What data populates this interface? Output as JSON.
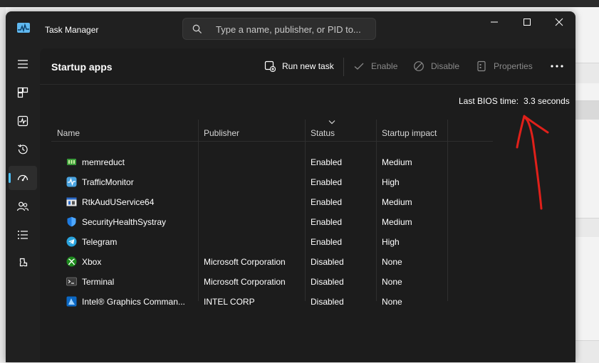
{
  "window": {
    "title": "Task Manager",
    "search_placeholder": "Type a name, publisher, or PID to..."
  },
  "sidebar": {
    "items": [
      {
        "name": "hamburger-menu-icon",
        "active": false
      },
      {
        "name": "processes-icon",
        "active": false
      },
      {
        "name": "performance-icon",
        "active": false
      },
      {
        "name": "app-history-icon",
        "active": false
      },
      {
        "name": "startup-apps-icon",
        "active": true
      },
      {
        "name": "users-icon",
        "active": false
      },
      {
        "name": "details-icon",
        "active": false
      },
      {
        "name": "services-icon",
        "active": false
      }
    ]
  },
  "toolbar": {
    "title": "Startup apps",
    "run_new_task": "Run new task",
    "enable": "Enable",
    "disable": "Disable",
    "properties": "Properties"
  },
  "bios": {
    "label": "Last BIOS time:",
    "value": "3.3 seconds"
  },
  "table": {
    "columns": [
      "Name",
      "Publisher",
      "Status",
      "Startup impact"
    ],
    "sorted_column": "Status",
    "rows": [
      {
        "icon": "memreduct-icon",
        "name": "memreduct",
        "publisher": "",
        "status": "Enabled",
        "impact": "Medium"
      },
      {
        "icon": "trafficmonitor-icon",
        "name": "TrafficMonitor",
        "publisher": "",
        "status": "Enabled",
        "impact": "High"
      },
      {
        "icon": "rtkaudio-icon",
        "name": "RtkAudUService64",
        "publisher": "",
        "status": "Enabled",
        "impact": "Medium"
      },
      {
        "icon": "security-shield-icon",
        "name": "SecurityHealthSystray",
        "publisher": "",
        "status": "Enabled",
        "impact": "Medium"
      },
      {
        "icon": "telegram-icon",
        "name": "Telegram",
        "publisher": "",
        "status": "Enabled",
        "impact": "High"
      },
      {
        "icon": "xbox-icon",
        "name": "Xbox",
        "publisher": "Microsoft Corporation",
        "status": "Disabled",
        "impact": "None"
      },
      {
        "icon": "terminal-icon",
        "name": "Terminal",
        "publisher": "Microsoft Corporation",
        "status": "Disabled",
        "impact": "None"
      },
      {
        "icon": "intel-graphics-icon",
        "name": "Intel® Graphics Comman...",
        "publisher": "INTEL CORP",
        "status": "Disabled",
        "impact": "None"
      }
    ]
  },
  "colors": {
    "window_bg": "#202020",
    "content_bg": "#1c1c1c",
    "accent": "#4cc2ff",
    "annotation": "#e0201a"
  }
}
